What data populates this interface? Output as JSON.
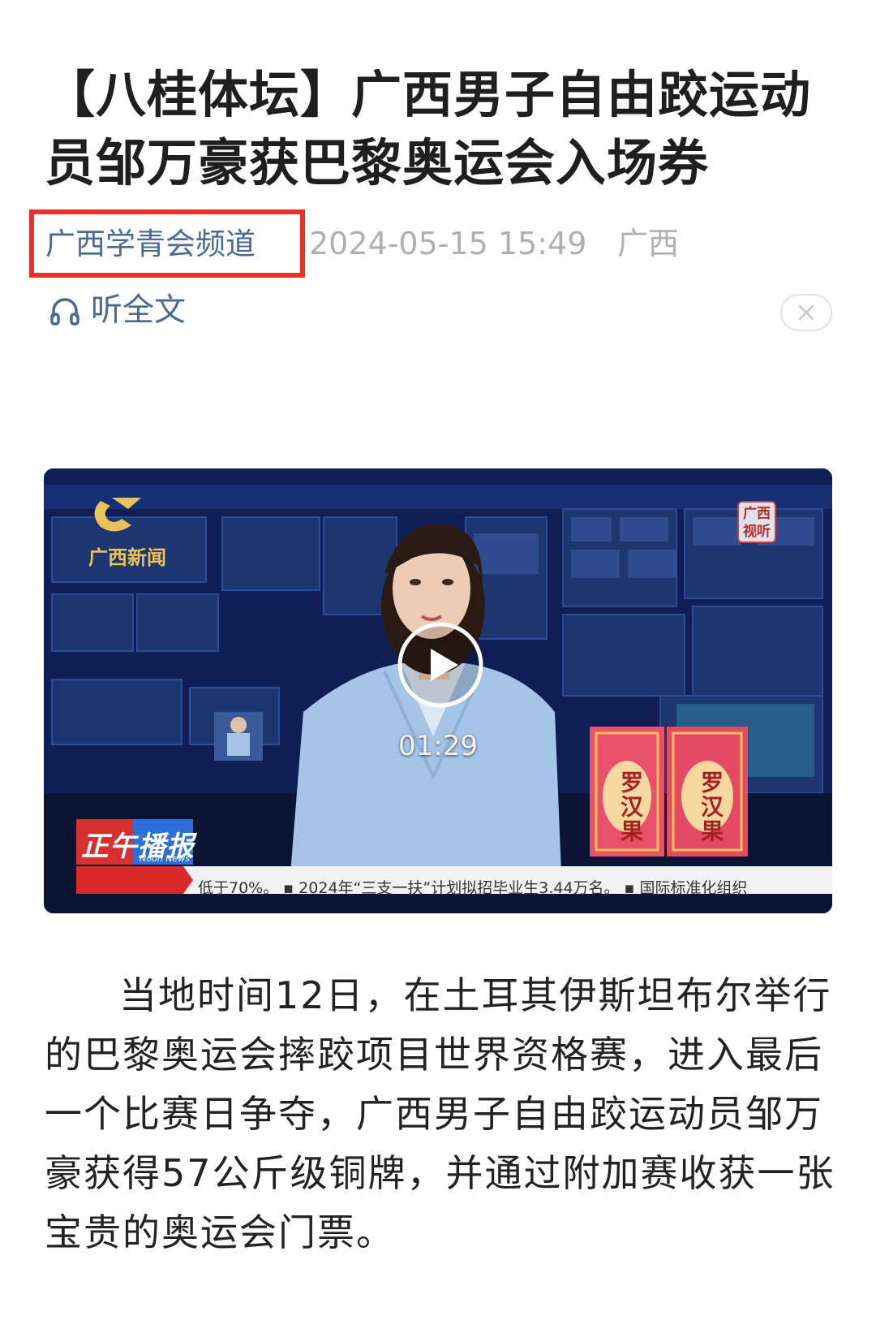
{
  "article": {
    "title": "【八桂体坛】广西男子自由跤运动员邹万豪获巴黎奥运会入场券",
    "source": "广西学青会频道",
    "date": "2024-05-15 15:49",
    "region": "广西",
    "listen_label": "听全文",
    "body": "当地时间12日，在土耳其伊斯坦布尔举行的巴黎奥运会摔跤项目世界资格赛，进入最后一个比赛日争夺，广西男子自由跤运动员邹万豪获得57公斤级铜牌，并通过附加赛收获一张宝贵的奥运会门票。"
  },
  "video": {
    "duration": "01:29",
    "channel_logo_text": "广西新闻",
    "corner_badge_text": "广西视听",
    "program_name_cn": "正午播报",
    "program_name_en": "Noon News",
    "ticker_text": "低于70%。  ▪ 2024年“三支一扶”计划拟招毕业生3.44万名。  ▪ 国际标准化组织",
    "product_label": "罗汉果"
  },
  "icons": {
    "listen": "headphones-icon",
    "close": "close-icon",
    "play": "play-icon"
  },
  "colors": {
    "highlight_border": "#e8322b",
    "link_blue": "#4a6a95",
    "meta_gray": "#b0b0b0"
  }
}
